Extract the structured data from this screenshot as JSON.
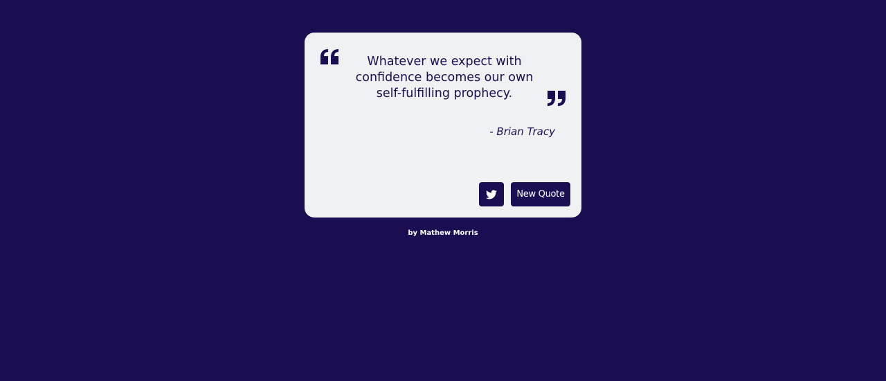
{
  "quote": {
    "text": "Whatever we expect with confidence becomes our own self-fulfilling prophecy.",
    "author": "- Brian Tracy"
  },
  "actions": {
    "tweet_icon": "twitter-icon",
    "new_quote_label": "New Quote"
  },
  "footer": {
    "credit": "by Mathew Morris"
  },
  "colors": {
    "background": "#1a0d52",
    "card": "#eff1f3",
    "accent": "#1a0d52",
    "button_text": "#ffffff"
  }
}
